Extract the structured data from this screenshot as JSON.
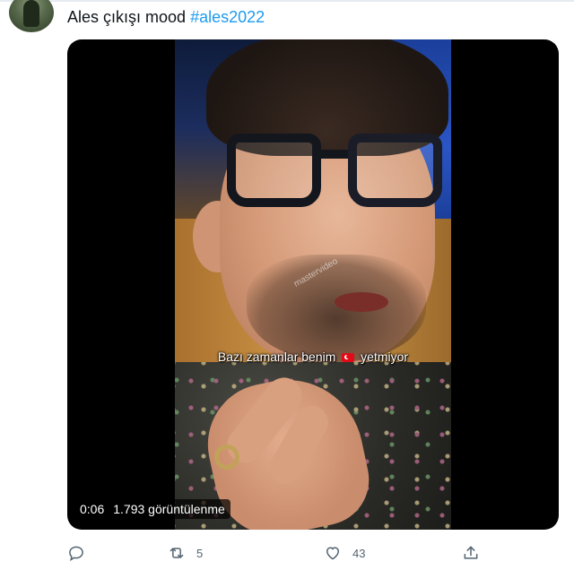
{
  "tweet": {
    "text": "Ales çıkışı mood ",
    "hashtag": "#ales2022"
  },
  "video": {
    "caption_before_flag": "Bazı zamanlar benim ",
    "caption_after_flag": " yetmiyor",
    "watermark": "mastervideo",
    "time": "0:06",
    "views": "1.793 görüntülenme"
  },
  "actions": {
    "reply_count": "",
    "retweet_count": "5",
    "like_count": "43"
  },
  "icons": {
    "reply": "reply-icon",
    "retweet": "retweet-icon",
    "like": "heart-icon",
    "share": "share-icon",
    "flag": "turkey-flag-emoji"
  },
  "colors": {
    "hashtag": "#1d9bf0",
    "text": "#0f1419",
    "action": "#536471"
  }
}
